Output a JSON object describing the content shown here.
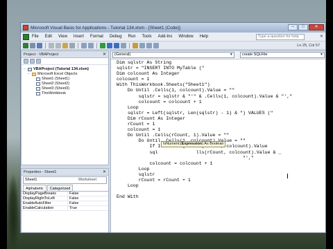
{
  "window": {
    "title": "Microsoft Visual Basic for Applications - Tutorial 134.xlsm - [Sheet1 (Code)]"
  },
  "menu": {
    "items": [
      "File",
      "Edit",
      "View",
      "Insert",
      "Format",
      "Debug",
      "Run",
      "Tools",
      "Add-Ins",
      "Window",
      "Help"
    ],
    "help_placeholder": "Type a question for help"
  },
  "toolbar": {
    "position": "Ln 25, Col 57"
  },
  "project": {
    "pane_title": "Project - VBAProject",
    "nodes": [
      {
        "label": "VBAProject (Tutorial 134.xlsm)",
        "expander": "−",
        "icon": "vba-project-icon"
      },
      {
        "label": "Microsoft Excel Objects",
        "expander": "−",
        "icon": "folder-icon"
      },
      {
        "label": "Sheet1 (Sheet1)",
        "expander": "",
        "icon": "sheet-icon"
      },
      {
        "label": "Sheet2 (Sheet2)",
        "expander": "",
        "icon": "sheet-icon"
      },
      {
        "label": "Sheet3 (Sheet3)",
        "expander": "",
        "icon": "sheet-icon"
      },
      {
        "label": "ThisWorkbook",
        "expander": "",
        "icon": "workbook-icon"
      }
    ]
  },
  "properties": {
    "pane_title": "Properties - Sheet1",
    "object_name": "Sheet1",
    "object_type": "Worksheet",
    "tabs": [
      "Alphabetic",
      "Categorized"
    ],
    "rows": [
      {
        "name": "DisplayPageBreaks",
        "value": "False"
      },
      {
        "name": "DisplayRightToLeft",
        "value": "False"
      },
      {
        "name": "EnableAutoFilter",
        "value": "False"
      },
      {
        "name": "EnableCalculation",
        "value": "True"
      }
    ]
  },
  "code": {
    "object_combo": "(General)",
    "procedure_combo": "create SQLFile",
    "lines": [
      "Dim sqlstr As String",
      "sqlstr = \"INSERT INTO MyTable (\"",
      "Dim colcount As Integer",
      "colcount = 1",
      "With ThisWorkbook.Sheets(\"Sheet1\")",
      "    Do Until .Cells(1, colcount).Value = \"\"",
      "        sqlstr = sqlstr & \"'\" & .Cells(1, colcount).Value & \"',\"",
      "        colcount = colcount + 1",
      "    Loop",
      "    sqlstr = Left(sqlstr, Len(sqlstr) - 1) & \") VALUES (\"",
      "    Dim rCount As Integer",
      "    rCount = 1",
      "    colcount = 1",
      "    Do Until .Cells(rCount, 1).Value = \"\"",
      "        Do Until .Cells(1, colcount).Value = \"\"",
      "            If IsNumeric(.Cells(rCount, colcount).Value",
      "            sql              lls(rCount, colcount).Value & _",
      "                                              \"',\"",
      "            colcount = colcount + 1",
      "        Loop",
      "        sqlstr",
      "        rCount = rCount + 1",
      "    Loop",
      "",
      "End With"
    ],
    "tooltip_prefix": "IsNumeric(",
    "tooltip_param": "Expression",
    "tooltip_suffix": ") As Boolean"
  }
}
